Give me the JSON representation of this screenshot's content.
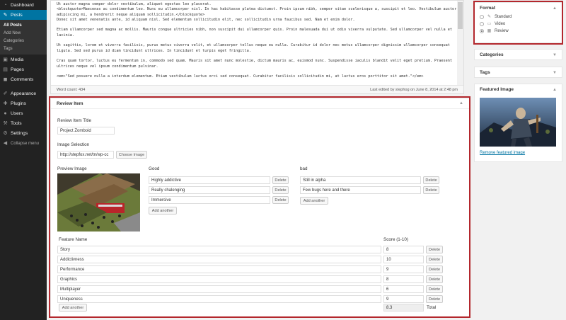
{
  "sidebar": {
    "items": [
      {
        "label": "Dashboard",
        "icon": "dashboard-icon"
      },
      {
        "label": "Posts",
        "icon": "pin-icon"
      },
      {
        "label": "Media",
        "icon": "media-icon"
      },
      {
        "label": "Pages",
        "icon": "pages-icon"
      },
      {
        "label": "Comments",
        "icon": "comments-icon"
      },
      {
        "label": "Appearance",
        "icon": "appearance-icon"
      },
      {
        "label": "Plugins",
        "icon": "plugins-icon"
      },
      {
        "label": "Users",
        "icon": "users-icon"
      },
      {
        "label": "Tools",
        "icon": "tools-icon"
      },
      {
        "label": "Settings",
        "icon": "settings-icon"
      }
    ],
    "posts_sub": [
      "All Posts",
      "Add New",
      "Categories",
      "Tags"
    ],
    "collapse": "Collapse menu"
  },
  "editor": {
    "paragraphs": [
      "Ut auctor magna semper dolor vestibulum, aliquet egestas leo placerat.\n<blockquote>Maecenas ac condimentum leo. Nunc eu ullamcorper nisl. In hac habitasse platea dictumst. Proin ipsum nibh, semper vitae scelerisque a, suscipit et leo. Vestibulum auctor adipiscing mi, a hendrerit neque aliquam sollicitudin.</blockquote>\nDonec sit amet venenatis ante, id aliquam nisl. Sed elementum sollicitudin elit, nec sollicitudin urna faucibus sed. Nam et enim dolor.",
      "Etiam ullamcorper sed magna ac mollis. Mauris congue ultricies nibh, non suscipit dui ullamcorper quis. Proin malesuada dui ut odio viverra vulputate. Sed ullamcorper vel nulla et lacinia.",
      "Ut sagittis, lorem et viverra facilisis, purus metus viverra velit, et ullamcorper tellus neque eu nulla. Curabitur id dolor nec metus ullamcorper dignissim ullamcorper consequat ligula. Sed sed purus id diam tincidunt ultrices. In tincidunt et turpis eget fringilla.",
      "Cras quam tortor, luctus eu fermentum in, commodo sed quam. Mauris sit amet nunc molestie, dictum mauris ac, euismod nunc. Suspendisse iaculis blandit velit eget pretium. Praesent ultrices neque vel ipsum condimentum pulvinar.",
      "<em>\"Sed posuere nulla a interdum elementum. Etiam vestibulum luctus orci sed consequat. Curabitur facilisis sollicitudin mi, at luctus eros porttitor sit amet.\"</em>"
    ],
    "word_count": "Word count: 434",
    "last_edited": "Last edited by stephog on June 8, 2014 at 2:48 pm"
  },
  "review": {
    "title": "Review Item",
    "item_title_label": "Review Item Title",
    "item_title_value": "Project Zomboid",
    "image_label": "Image Selection",
    "image_value": "http://stepfox.net/tn/wp-cc",
    "choose_image": "Choose Image",
    "preview_label": "Preview Image",
    "good_label": "Good",
    "good": [
      "Highly addictive",
      "Really chalenging",
      "Immersive"
    ],
    "bad_label": "bad",
    "bad": [
      "Still in alpha",
      "Few bugs here and there"
    ],
    "delete": "Delete",
    "add_another": "Add another",
    "feature_header": "Feature Name",
    "score_header": "Score (1-10)",
    "features": [
      {
        "name": "Story",
        "score": "8"
      },
      {
        "name": "Addictivness",
        "score": "10"
      },
      {
        "name": "Performance",
        "score": "9"
      },
      {
        "name": "Graphics",
        "score": "8"
      },
      {
        "name": "Multiplayer",
        "score": "6"
      },
      {
        "name": "Uniqueness",
        "score": "9"
      }
    ],
    "total_value": "8.3",
    "total_label": "Total"
  },
  "format": {
    "title": "Format",
    "options": [
      {
        "label": "Standard",
        "icon": "pin-icon",
        "checked": false
      },
      {
        "label": "Video",
        "icon": "video-icon",
        "checked": false
      },
      {
        "label": "Review",
        "icon": "review-icon",
        "checked": true
      }
    ]
  },
  "categories": {
    "title": "Categories"
  },
  "tags": {
    "title": "Tags"
  },
  "featured": {
    "title": "Featured Image",
    "remove": "Remove featured image"
  },
  "highlight_color": "#b3272d"
}
